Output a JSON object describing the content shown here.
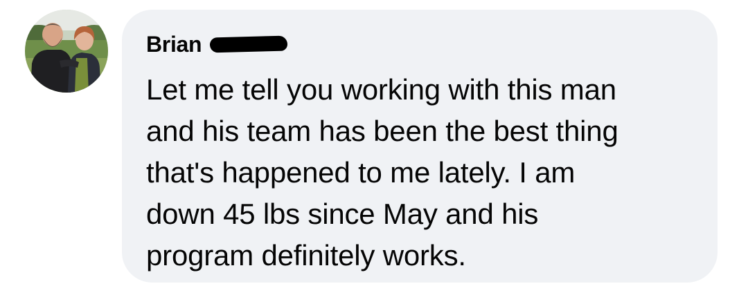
{
  "comment": {
    "author": "Brian",
    "text": "Let me tell you working with this man\nand his team has been the best thing\nthat's happened to me lately. I am\ndown 45 lbs since May and his\nprogram definitely works."
  },
  "colors": {
    "bubble_background": "#f0f2f5",
    "text": "#050505",
    "redaction": "#000000"
  },
  "icons": {
    "avatar": "profile-photo-avatar"
  }
}
